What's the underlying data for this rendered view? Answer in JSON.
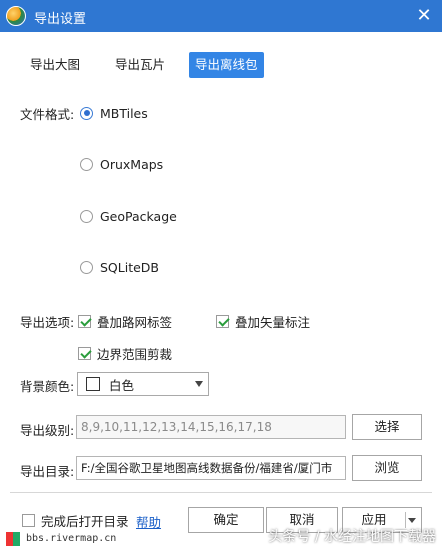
{
  "window": {
    "title": "导出设置"
  },
  "tabs": [
    {
      "label": "导出大图",
      "active": false
    },
    {
      "label": "导出瓦片",
      "active": false
    },
    {
      "label": "导出离线包",
      "active": true
    }
  ],
  "file_format": {
    "label": "文件格式:",
    "options": [
      {
        "label": "MBTiles",
        "checked": true
      },
      {
        "label": "OruxMaps",
        "checked": false
      },
      {
        "label": "GeoPackage",
        "checked": false
      },
      {
        "label": "SQLiteDB",
        "checked": false
      }
    ]
  },
  "export_options": {
    "label": "导出选项:",
    "items": [
      {
        "label": "叠加路网标签",
        "checked": true
      },
      {
        "label": "叠加矢量标注",
        "checked": true
      },
      {
        "label": "边界范围剪裁",
        "checked": true
      }
    ]
  },
  "background_color": {
    "label": "背景颜色:",
    "value": "白色",
    "swatch": "#ffffff"
  },
  "export_level": {
    "label": "导出级别:",
    "value": "8,9,10,11,12,13,14,15,16,17,18",
    "button": "选择"
  },
  "export_dir": {
    "label": "导出目录:",
    "value": "F:/全国谷歌卫星地图高线数据备份/福建省/厦门市",
    "button": "浏览"
  },
  "footer": {
    "open_after_label": "完成后打开目录",
    "open_after_checked": false,
    "help_label": "帮助",
    "ok_label": "确定",
    "cancel_label": "取消",
    "apply_label": "应用"
  },
  "watermark": {
    "site": "bbs.rivermap.cn",
    "overlay": "头条号 / 水经注地图下载器"
  },
  "colors": {
    "titlebar": "#2f77d2",
    "active_tab": "#3385e5",
    "link": "#1a5fc8",
    "check": "#2a9d3c"
  }
}
